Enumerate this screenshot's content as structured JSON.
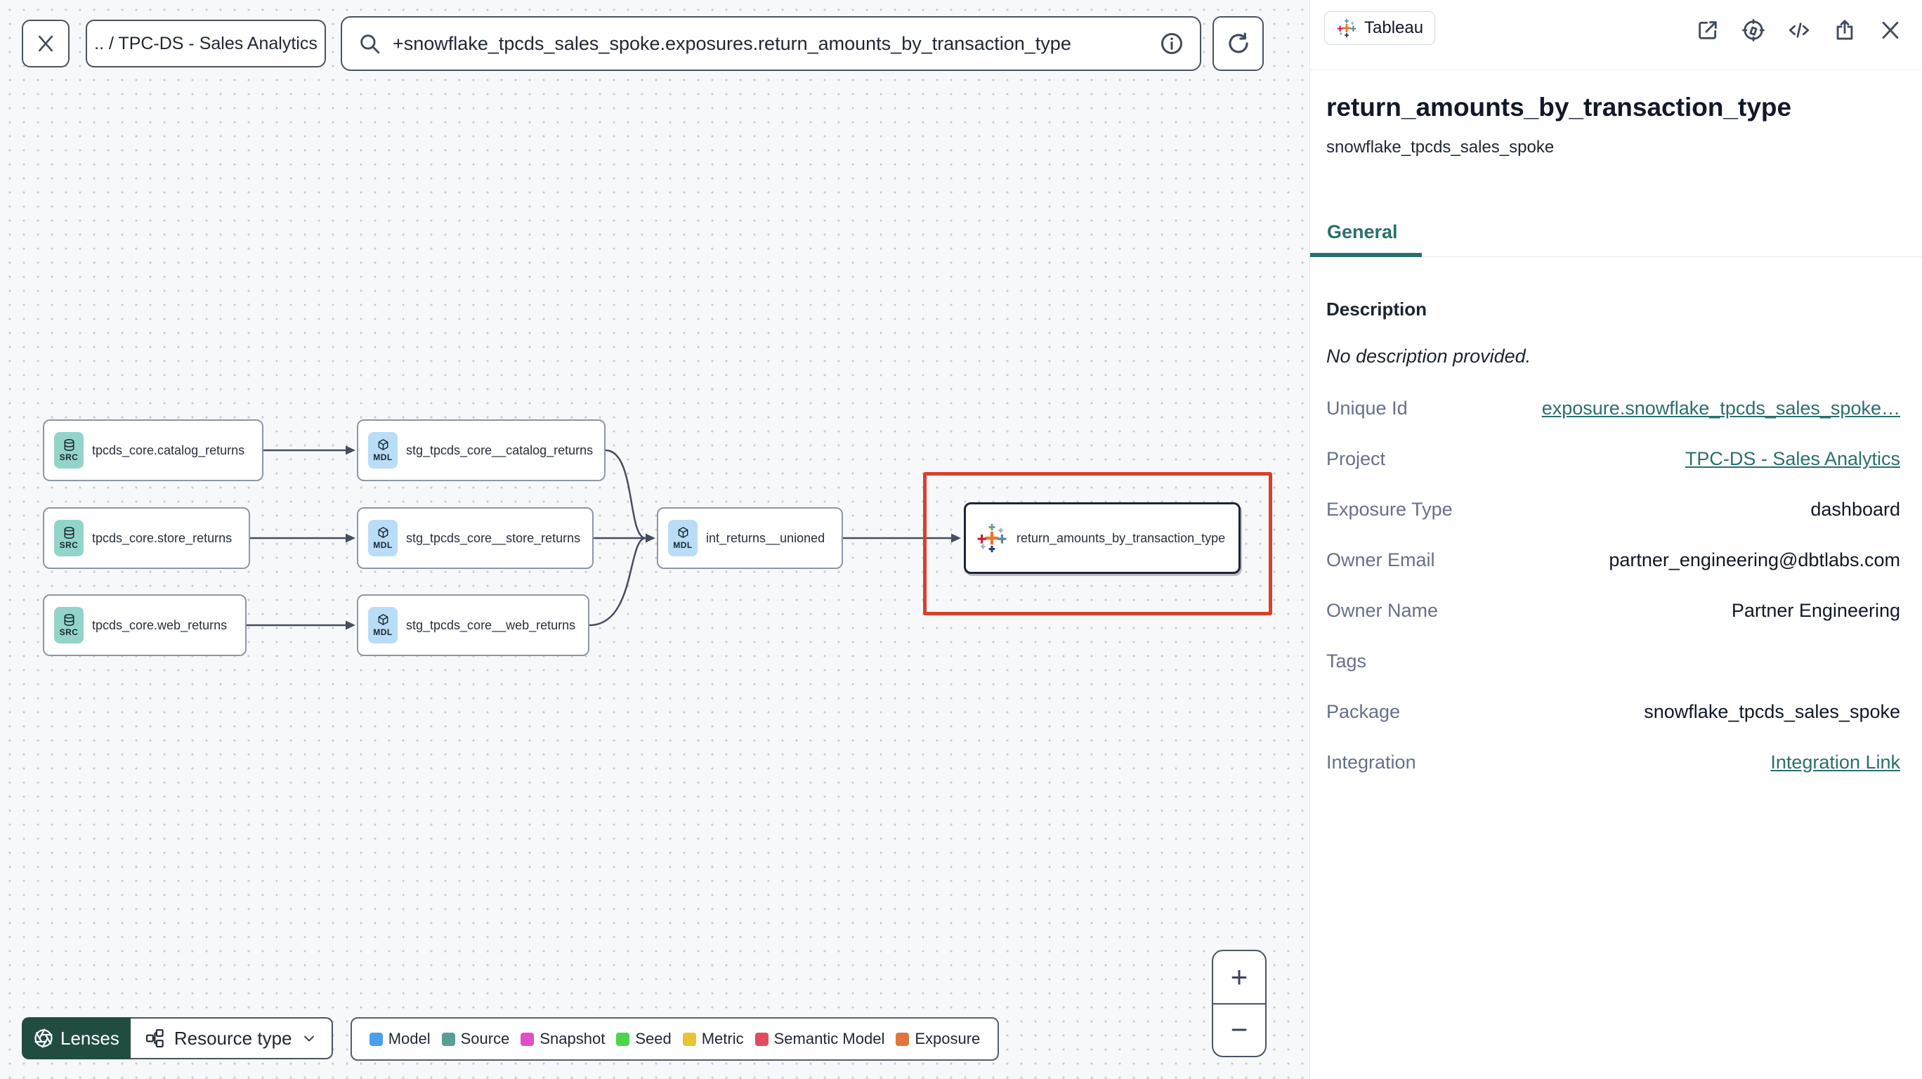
{
  "topbar": {
    "breadcrumb": ".. / TPC-DS - Sales Analytics",
    "search_value": "+snowflake_tpcds_sales_spoke.exposures.return_amounts_by_transaction_type"
  },
  "canvas": {
    "nodes": [
      {
        "badge": "SRC",
        "type": "source",
        "label": "tpcds_core.catalog_returns"
      },
      {
        "badge": "SRC",
        "type": "source",
        "label": "tpcds_core.store_returns"
      },
      {
        "badge": "SRC",
        "type": "source",
        "label": "tpcds_core.web_returns"
      },
      {
        "badge": "MDL",
        "type": "model",
        "label": "stg_tpcds_core__catalog_returns"
      },
      {
        "badge": "MDL",
        "type": "model",
        "label": "stg_tpcds_core__store_returns"
      },
      {
        "badge": "MDL",
        "type": "model",
        "label": "stg_tpcds_core__web_returns"
      },
      {
        "badge": "MDL",
        "type": "model",
        "label": "int_returns__unioned"
      },
      {
        "badge": "",
        "type": "exposure",
        "label": "return_amounts_by_transaction_type"
      }
    ]
  },
  "toolbar": {
    "lenses_label": "Lenses",
    "resource_type_label": "Resource type"
  },
  "legend": {
    "items": [
      {
        "label": "Model",
        "color": "#4a9eea"
      },
      {
        "label": "Source",
        "color": "#589e99"
      },
      {
        "label": "Snapshot",
        "color": "#e04fc6"
      },
      {
        "label": "Seed",
        "color": "#4cd44d"
      },
      {
        "label": "Metric",
        "color": "#e7c433"
      },
      {
        "label": "Semantic Model",
        "color": "#e34a5f"
      },
      {
        "label": "Exposure",
        "color": "#e0763f"
      }
    ]
  },
  "zoom_controls": {
    "zoom_in": "+",
    "zoom_out": "−"
  },
  "panel": {
    "badge_label": "Tableau",
    "title": "return_amounts_by_transaction_type",
    "subtitle": "snowflake_tpcds_sales_spoke",
    "tabs": [
      {
        "label": "General",
        "active": true
      }
    ],
    "description_heading": "Description",
    "description_empty": "No description provided.",
    "fields": [
      {
        "label": "Unique Id",
        "value": "exposure.snowflake_tpcds_sales_spoke…",
        "link": true
      },
      {
        "label": "Project",
        "value": "TPC-DS - Sales Analytics",
        "link": true
      },
      {
        "label": "Exposure Type",
        "value": "dashboard",
        "link": false
      },
      {
        "label": "Owner Email",
        "value": "partner_engineering@dbtlabs.com",
        "link": false
      },
      {
        "label": "Owner Name",
        "value": "Partner Engineering",
        "link": false
      },
      {
        "label": "Tags",
        "value": "",
        "link": false
      },
      {
        "label": "Package",
        "value": "snowflake_tpcds_sales_spoke",
        "link": false
      },
      {
        "label": "Integration",
        "value": "Integration Link",
        "link": true
      }
    ]
  },
  "colors": {
    "accent_teal": "#2a6f6d",
    "highlight_red": "#d8402a",
    "lenses_green": "#214c42"
  }
}
